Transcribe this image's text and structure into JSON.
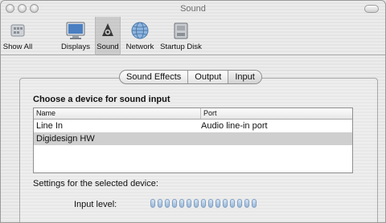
{
  "window": {
    "title": "Sound"
  },
  "toolbar": {
    "items": [
      {
        "label": "Show All",
        "icon": "show-all-icon"
      },
      {
        "label": "Displays",
        "icon": "displays-icon"
      },
      {
        "label": "Sound",
        "icon": "sound-icon"
      },
      {
        "label": "Network",
        "icon": "network-icon"
      },
      {
        "label": "Startup Disk",
        "icon": "startup-disk-icon"
      }
    ],
    "selected": "Sound"
  },
  "tabs": [
    "Sound Effects",
    "Output",
    "Input"
  ],
  "active_tab": "Input",
  "input": {
    "section_title": "Choose a device for sound input",
    "columns": {
      "name": "Name",
      "port": "Port"
    },
    "devices": [
      {
        "name": "Line In",
        "port": "Audio line-in port"
      },
      {
        "name": "Digidesign HW",
        "port": ""
      }
    ],
    "selected_device": "Digidesign HW",
    "settings_label": "Settings for the selected device:",
    "input_level_label": "Input level:",
    "input_level_segments": 15,
    "input_level_value": 0
  },
  "colors": {
    "meter_segment": "#98b6d6",
    "selected_row": "#cfcfcf"
  }
}
